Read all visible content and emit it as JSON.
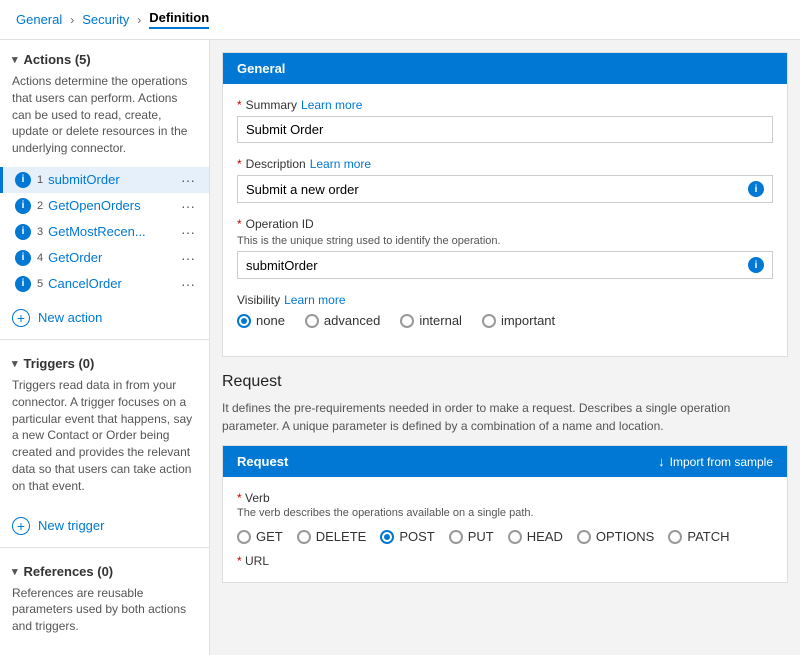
{
  "breadcrumb": {
    "items": [
      {
        "label": "General",
        "active": false
      },
      {
        "label": "Security",
        "active": false
      },
      {
        "label": "Definition",
        "active": true
      }
    ]
  },
  "sidebar": {
    "actions_header": "Actions (5)",
    "actions_desc": "Actions determine the operations that users can perform. Actions can be used to read, create, update or delete resources in the underlying connector.",
    "actions": [
      {
        "num": "1",
        "name": "submitOrder",
        "selected": true
      },
      {
        "num": "2",
        "name": "GetOpenOrders",
        "selected": false
      },
      {
        "num": "3",
        "name": "GetMostRecen...",
        "selected": false
      },
      {
        "num": "4",
        "name": "GetOrder",
        "selected": false
      },
      {
        "num": "5",
        "name": "CancelOrder",
        "selected": false
      }
    ],
    "new_action_label": "New action",
    "triggers_header": "Triggers (0)",
    "triggers_desc": "Triggers read data in from your connector. A trigger focuses on a particular event that happens, say a new Contact or Order being created and provides the relevant data so that users can take action on that event.",
    "new_trigger_label": "New trigger",
    "references_header": "References (0)",
    "references_desc": "References are reusable parameters used by both actions and triggers."
  },
  "general_panel": {
    "header": "General",
    "summary_label": "Summary",
    "summary_learn_more": "Learn more",
    "summary_value": "Submit Order",
    "description_label": "Description",
    "description_learn_more": "Learn more",
    "description_value": "Submit a new order",
    "operation_id_label": "Operation ID",
    "operation_id_hint": "This is the unique string used to identify the operation.",
    "operation_id_value": "submitOrder",
    "visibility_label": "Visibility",
    "visibility_learn_more": "Learn more",
    "visibility_options": [
      "none",
      "advanced",
      "internal",
      "important"
    ],
    "visibility_selected": "none"
  },
  "request_section": {
    "title": "Request",
    "desc": "It defines the pre-requirements needed in order to make a request. Describes a single operation parameter. A unique parameter is defined by a combination of a name and location.",
    "header": "Request",
    "import_label": "Import from sample",
    "verb_label": "Verb",
    "verb_hint": "The verb describes the operations available on a single path.",
    "verbs": [
      "GET",
      "DELETE",
      "POST",
      "PUT",
      "HEAD",
      "OPTIONS",
      "PATCH"
    ],
    "verb_selected": "POST",
    "url_label": "URL"
  },
  "icons": {
    "info": "i",
    "chevron_down": "▾",
    "chevron_right": "›",
    "more": "···",
    "plus": "+",
    "import_arrow": "↓"
  }
}
